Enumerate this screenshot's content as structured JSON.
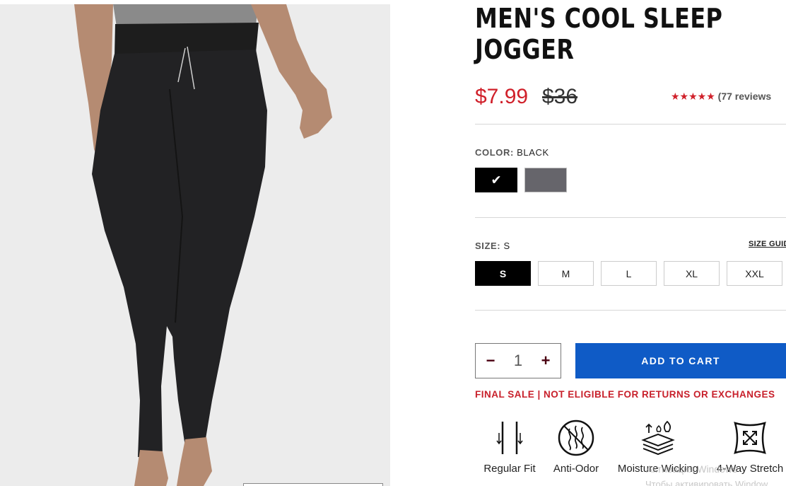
{
  "product": {
    "title_line1": "MEN'S COOL SLEEP",
    "title_line2": "JOGGER",
    "sale_price": "$7.99",
    "original_price": "$36",
    "stars": "★★★★★",
    "reviews": "(77 reviews"
  },
  "color": {
    "key": "COLOR:",
    "selected": "BLACK",
    "swatches": [
      "black",
      "grey"
    ],
    "check": "✔"
  },
  "size": {
    "key": "SIZE:",
    "selected": "S",
    "guide": "SIZE GUID",
    "options": [
      "S",
      "M",
      "L",
      "XL",
      "XXL"
    ]
  },
  "cart": {
    "minus": "−",
    "quantity": "1",
    "plus": "+",
    "add_label": "ADD TO CART"
  },
  "notice": "FINAL SALE | NOT ELIGIBLE FOR RETURNS OR EXCHANGES",
  "features": [
    {
      "label": "Regular Fit",
      "icon": "regular-fit-icon"
    },
    {
      "label": "Anti-Odor",
      "icon": "anti-odor-icon"
    },
    {
      "label": "Moisture Wicking",
      "icon": "moisture-wicking-icon"
    },
    {
      "label": "4-Way Stretch",
      "icon": "four-way-stretch-icon"
    }
  ],
  "watermark": {
    "line1": "Активация Windows",
    "line2": "Чтобы активировать Window"
  },
  "colors": {
    "sale": "#d0202a",
    "cta": "#0f5bc6",
    "notice": "#c8202b"
  }
}
